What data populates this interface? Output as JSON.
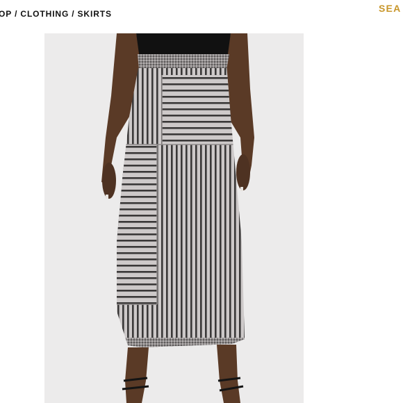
{
  "breadcrumb": {
    "items": [
      "OP",
      "CLOTHING",
      "SKIRTS"
    ],
    "separator": "/"
  },
  "search": {
    "label": "SEA"
  },
  "colors": {
    "accent": "#c8962a",
    "text": "#111111",
    "photo_bg": "#ecebeb"
  },
  "product_image": {
    "subject": "grey and black striped knit midi skirt"
  }
}
